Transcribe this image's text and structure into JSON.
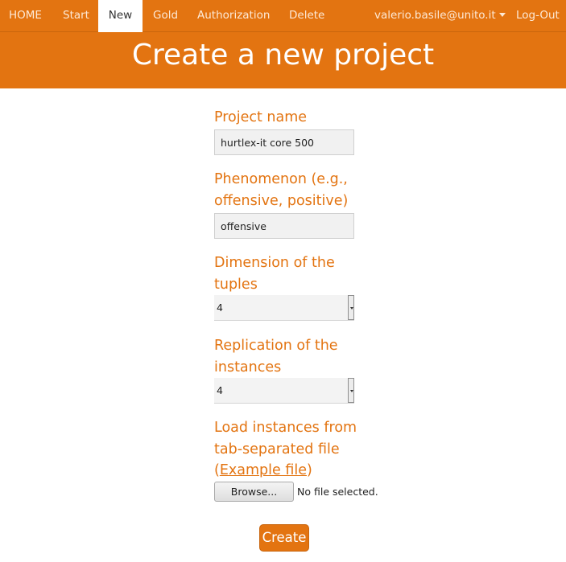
{
  "nav": {
    "home": "HOME",
    "start": "Start",
    "new": "New",
    "gold": "Gold",
    "authorization": "Authorization",
    "delete": "Delete",
    "user": "valerio.basile@unito.it",
    "logout": "Log-Out"
  },
  "page_title": "Create a new project",
  "form": {
    "project_name": {
      "label": "Project name",
      "value": "hurtlex-it core 500"
    },
    "phenomenon": {
      "label": "Phenomenon (e.g., offensive, positive)",
      "value": "offensive"
    },
    "dimension": {
      "label": "Dimension of the tuples",
      "value": "4"
    },
    "replication": {
      "label": "Replication of the instances",
      "value": "4"
    },
    "load": {
      "label_prefix": "Load instances from tab-separated file (",
      "link": "Example file",
      "label_suffix": ")",
      "browse": "Browse...",
      "status": "No file selected."
    },
    "create": "Create"
  },
  "colors": {
    "accent": "#e37411",
    "banner_text": "#ffffff"
  },
  "icons": {
    "user_menu": "caret-down-icon",
    "select": "dropdown-arrow-icon"
  }
}
